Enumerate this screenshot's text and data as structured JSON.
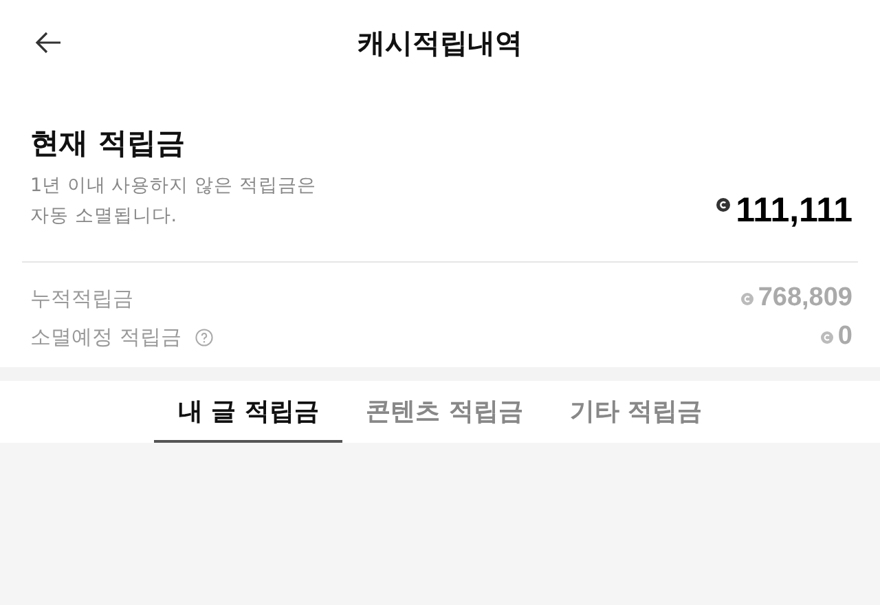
{
  "header": {
    "title": "캐시적립내역"
  },
  "current": {
    "title": "현재 적립금",
    "note_lines": [
      "1년 이내 사용하지 않은 적립금은",
      "자동 소멸됩니다."
    ],
    "amount": "111,111"
  },
  "summary": [
    {
      "label": "누적적립금",
      "amount": "768,809",
      "help": false
    },
    {
      "label": "소멸예정 적립금",
      "amount": "0",
      "help": true
    }
  ],
  "tabs": [
    {
      "label": "내 글 적립금",
      "selected": true
    },
    {
      "label": "콘텐츠 적립금",
      "selected": false
    },
    {
      "label": "기타 적립금",
      "selected": false
    }
  ]
}
